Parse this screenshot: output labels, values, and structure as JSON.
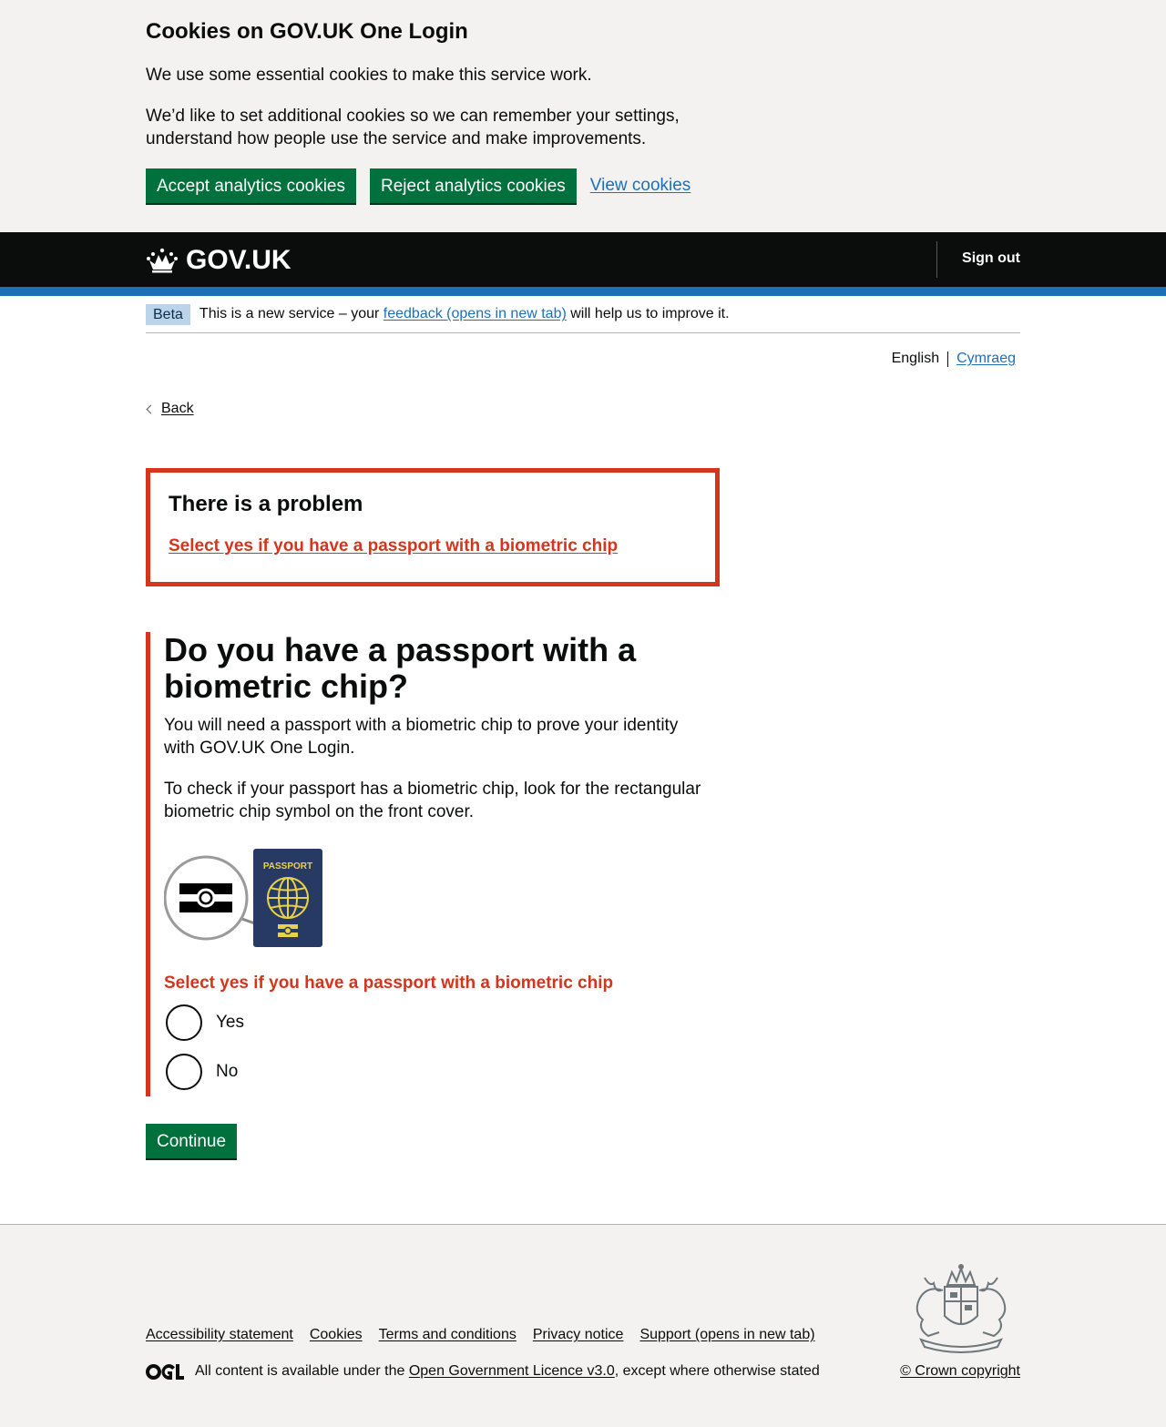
{
  "cookie_banner": {
    "title": "Cookies on GOV.UK One Login",
    "p1": "We use some essential cookies to make this service work.",
    "p2": "We’d like to set additional cookies so we can remember your settings, understand how people use the service and make improvements.",
    "accept_label": "Accept analytics cookies",
    "reject_label": "Reject analytics cookies",
    "view_label": "View cookies"
  },
  "header": {
    "logo_text": "GOV.UK",
    "signout_label": "Sign out"
  },
  "phase_banner": {
    "tag": "Beta",
    "text_before": "This is a new service – your",
    "link": "feedback (opens in new tab)",
    "text_after": "will help us to improve it."
  },
  "language": {
    "current": "English",
    "other": "Cymraeg"
  },
  "back_label": "Back",
  "error_summary": {
    "title": "There is a problem",
    "link": "Select yes if you have a passport with a biometric chip"
  },
  "question": {
    "title": "Do you have a passport with a biometric chip?",
    "p1": "You will need a passport with a biometric chip to prove your identity with GOV.UK One Login.",
    "p2": "To check if your passport has a biometric chip, look for the rectangular biometric chip symbol on the front cover.",
    "passport_cover_text": "PASSPORT",
    "error_message": "Select yes if you have a passport with a biometric chip",
    "options": [
      "Yes",
      "No"
    ]
  },
  "continue_label": "Continue",
  "footer": {
    "links": [
      "Accessibility statement",
      "Cookies",
      "Terms and conditions",
      "Privacy notice",
      "Support (opens in new tab)"
    ],
    "licence_before": "All content is available under the",
    "licence_link": "Open Government Licence v3.0",
    "licence_after": ", except where otherwise stated",
    "copyright": "© Crown copyright"
  },
  "colors": {
    "button_green": "#00703c",
    "link_blue": "#1d70b8",
    "error_red": "#d4351c",
    "header_black": "#0b0c0c"
  }
}
